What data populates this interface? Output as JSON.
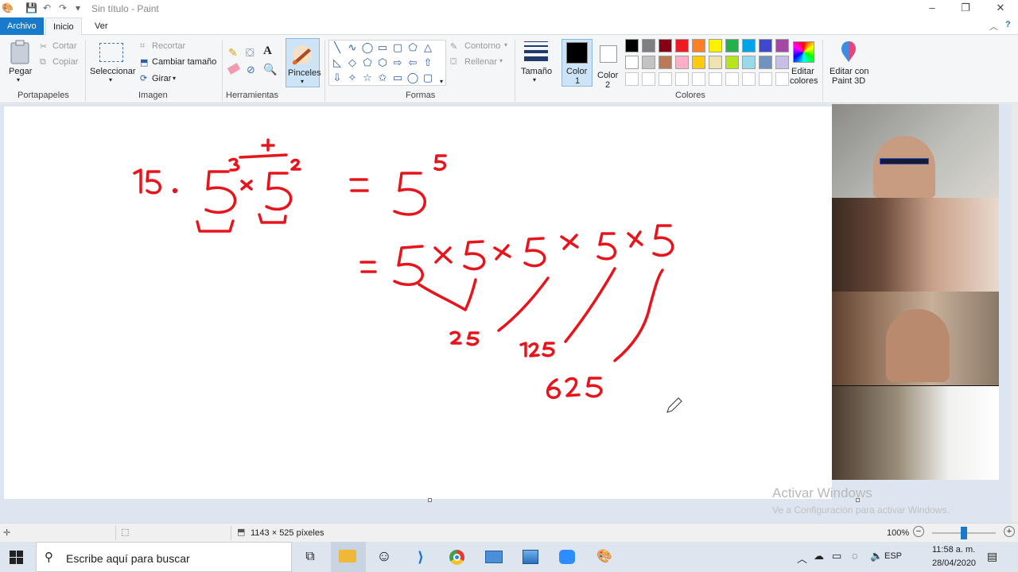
{
  "window": {
    "title": "Sin título - Paint"
  },
  "menu": {
    "archivo": "Archivo",
    "inicio": "Inicio",
    "ver": "Ver"
  },
  "ribbon": {
    "portapapeles": {
      "label": "Portapapeles",
      "pegar": "Pegar",
      "cortar": "Cortar",
      "copiar": "Copiar"
    },
    "imagen": {
      "label": "Imagen",
      "seleccionar": "Seleccionar",
      "recortar": "Recortar",
      "cambiar": "Cambiar tamaño",
      "girar": "Girar"
    },
    "herramientas": {
      "label": "Herramientas"
    },
    "pinceles": "Pinceles",
    "formas": {
      "label": "Formas",
      "contorno": "Contorno",
      "rellenar": "Rellenar"
    },
    "tamano": "Tamaño",
    "color1": "Color",
    "color1_num": "1",
    "color2": "Color",
    "color2_num": "2",
    "colores": {
      "label": "Colores",
      "editar": "Editar",
      "editar2": "colores"
    },
    "paint3d": {
      "line1": "Editar con",
      "line2": "Paint 3D"
    }
  },
  "colors": {
    "color1": "#000000",
    "color2": "#ffffff",
    "palette_row1": [
      "#000000",
      "#7f7f7f",
      "#880015",
      "#ed1c24",
      "#ff7f27",
      "#fff200",
      "#22b14c",
      "#00a2e8",
      "#3f48cc",
      "#a349a4"
    ],
    "palette_row2": [
      "#ffffff",
      "#c3c3c3",
      "#b97a57",
      "#ffaec9",
      "#ffc90e",
      "#efe4b0",
      "#b5e61d",
      "#99d9ea",
      "#7092be",
      "#c8bfe7"
    ],
    "ink": "#e8141c"
  },
  "canvas": {
    "notes": {
      "n15": "15.",
      "exp3": "3",
      "exp2": "2",
      "plus": "+",
      "exp5": "5",
      "v25": "25",
      "v125": "125",
      "v625": "625"
    }
  },
  "status": {
    "dimensions": "1143 × 525 píxeles",
    "zoom": "100%"
  },
  "watermark": {
    "line1": "Activar Windows",
    "line2": "Ve a Configuración para activar Windows."
  },
  "taskbar": {
    "search": "Escribe aquí para buscar",
    "lang": "ESP",
    "time": "11:58 a. m.",
    "date": "28/04/2020"
  }
}
